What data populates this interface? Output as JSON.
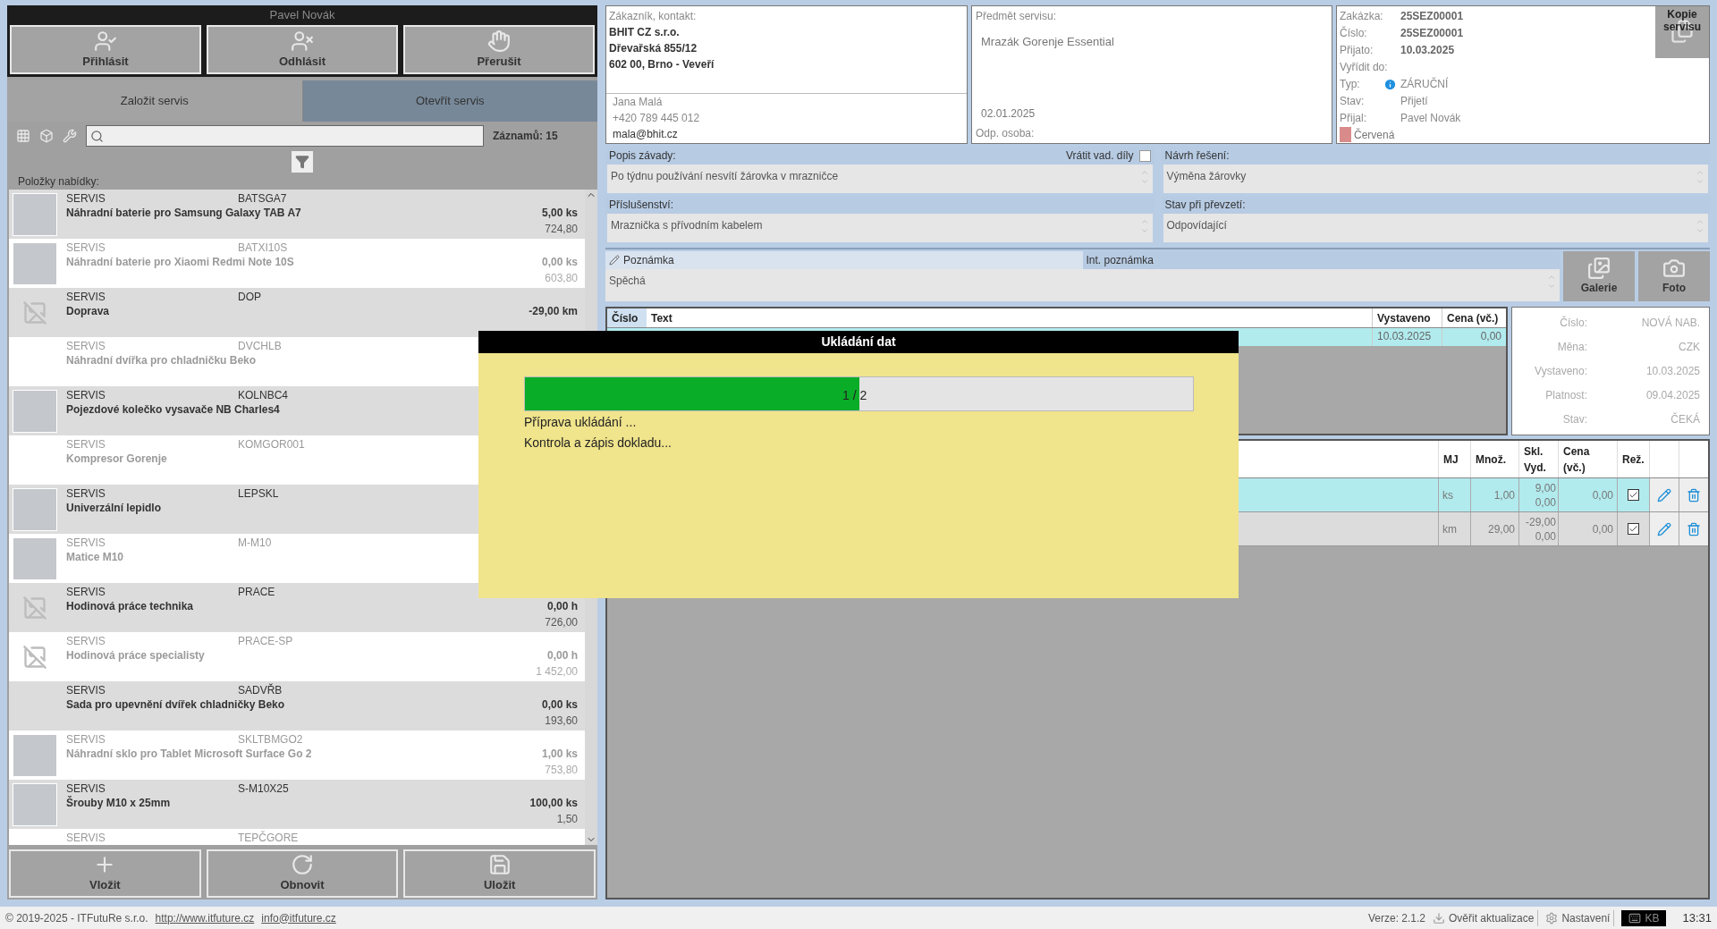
{
  "user": "Pavel Novák",
  "top_buttons": [
    {
      "label": "Přihlásit"
    },
    {
      "label": "Odhlásit"
    },
    {
      "label": "Přerušit"
    }
  ],
  "tabs": [
    {
      "label": "Založit servis",
      "selected": false
    },
    {
      "label": "Otevřít servis",
      "selected": true
    }
  ],
  "records": "Záznamů: 15",
  "list_title": "Položky nabídky:",
  "items": [
    {
      "category": "SERVIS",
      "code": "BATSGA7",
      "name": "Náhradní baterie pro Samsung Galaxy TAB A7",
      "qty": "5,00 ks",
      "price": "724,80",
      "kind": "photo",
      "available": true
    },
    {
      "category": "SERVIS",
      "code": "BATXI10S",
      "name": "Náhradní baterie pro Xiaomi Redmi Note 10S",
      "qty": "0,00 ks",
      "price": "603,80",
      "kind": "photo",
      "available": false
    },
    {
      "category": "SERVIS",
      "code": "DOP",
      "name": "Doprava",
      "qty": "-29,00 km",
      "kind": "no-image",
      "available": true
    },
    {
      "category": "SERVIS",
      "code": "DVCHLB",
      "name": "Náhradní dvířka pro chladničku Beko",
      "available": false
    },
    {
      "category": "SERVIS",
      "code": "KOLNBC4",
      "name": "Pojezdové kolečko vysavače NB Charles4",
      "kind": "photo",
      "available": true
    },
    {
      "category": "SERVIS",
      "code": "KOMGOR001",
      "name": "Kompresor Gorenje",
      "available": false
    },
    {
      "category": "SERVIS",
      "code": "LEPSKL",
      "name": "Univerzální lepidlo",
      "kind": "photo",
      "available": true
    },
    {
      "category": "SERVIS",
      "code": "M-M10",
      "name": "Matice M10",
      "kind": "photo",
      "available": false
    },
    {
      "category": "SERVIS",
      "code": "PRACE",
      "name": "Hodinová práce technika",
      "qty": "0,00 h",
      "price": "726,00",
      "kind": "no-image",
      "available": true
    },
    {
      "category": "SERVIS",
      "code": "PRACE-SP",
      "name": "Hodinová práce specialisty",
      "qty": "0,00 h",
      "price": "1 452,00",
      "kind": "no-image",
      "available": false
    },
    {
      "category": "SERVIS",
      "code": "SADVŘB",
      "name": "Sada pro upevnění dvířek chladničky Beko",
      "qty": "0,00 ks",
      "price": "193,60",
      "available": true
    },
    {
      "category": "SERVIS",
      "code": "SKLTBMGO2",
      "name": "Náhradní sklo pro Tablet Microsoft Surface Go 2",
      "qty": "1,00 ks",
      "price": "753,80",
      "kind": "photo",
      "available": false
    },
    {
      "category": "SERVIS",
      "code": "S-M10X25",
      "name": "Šrouby M10 x 25mm",
      "qty": "100,00 ks",
      "price": "1,50",
      "kind": "photo",
      "available": true
    },
    {
      "category": "SERVIS",
      "code": "TEPČGORE",
      "available": false
    }
  ],
  "bottom_buttons": [
    {
      "label": "Vložit"
    },
    {
      "label": "Obnovit"
    },
    {
      "label": "Uložit"
    }
  ],
  "customer": {
    "label": "Zákazník, kontakt:",
    "lines": [
      "BHIT CZ s.r.o.",
      "Dřevařská 855/12",
      "602 00, Brno - Veveří"
    ],
    "contact": [
      "Jana Malá",
      "+420 789 445 012"
    ],
    "email": "mala@bhit.cz"
  },
  "subject": {
    "label": "Předmět servisu:",
    "value": "Mrazák Gorenje Essential",
    "date": "02.01.2025",
    "person_label": "Odp. osoba:"
  },
  "order": {
    "fields": [
      {
        "label": "Zakázka:",
        "value": "25SEZ00001",
        "bold": true
      },
      {
        "label": "Číslo:",
        "value": "25SEZ00001",
        "bold": true
      },
      {
        "label": "Přijato:",
        "value": "10.03.2025",
        "bold": true
      },
      {
        "label": "Vyřídit do:"
      },
      {
        "label": "Typ:",
        "value": "ZÁRUČNÍ",
        "info": true,
        "bold": false
      },
      {
        "label": "Stav:",
        "value": "Přijetí",
        "bold": false
      },
      {
        "label": "Přijal:",
        "value": "Pavel Novák",
        "bold": false
      }
    ],
    "tag": {
      "label": "Červená",
      "color": "#d98b8b"
    },
    "copy_button": "Kopie servisu"
  },
  "description": {
    "label": "Popis závady:",
    "value": "Po týdnu používání nesvítí žárovka v mrazničce",
    "return_label": "Vrátit vad. díly",
    "return_checked": false
  },
  "solution": {
    "label": "Návrh řešení:",
    "value": "Výměna žárovky"
  },
  "accessories": {
    "label": "Příslušenství:",
    "value": "Mraznička s přívodním kabelem"
  },
  "condition": {
    "label": "Stav při převzetí:",
    "value": "Odpovídající"
  },
  "note_tabs": [
    {
      "label": "Poznámka",
      "selected": true
    },
    {
      "label": "Int. poznámka",
      "selected": false
    }
  ],
  "note": "Spěchá",
  "media_buttons": [
    {
      "label": "Galerie"
    },
    {
      "label": "Foto"
    }
  ],
  "offers": {
    "columns": [
      "Číslo",
      "Text",
      "Vystaveno",
      "Cena (vč.)"
    ],
    "rows": [
      {
        "issued": "10.03.2025",
        "price": "0,00",
        "selected": true
      }
    ]
  },
  "offer_info": [
    {
      "label": "Číslo:",
      "value": "NOVÁ NAB."
    },
    {
      "label": "Měna:",
      "value": "CZK"
    },
    {
      "label": "Vystaveno:",
      "value": "10.03.2025"
    },
    {
      "label": "Platnost:",
      "value": "09.04.2025"
    },
    {
      "label": "Stav:",
      "value": "ČEKÁ"
    }
  ],
  "lines": {
    "columns": [
      "MJ",
      "Množ.",
      "Skl. Vyd.",
      "Cena (vč.)",
      "Rež."
    ],
    "rows": [
      {
        "unit": "ks",
        "qty": "1,00",
        "stock": [
          "9,00",
          "0,00"
        ],
        "price": "0,00",
        "overhead": true,
        "selected": true
      },
      {
        "unit": "km",
        "qty": "29,00",
        "stock": [
          "-29,00",
          "0,00"
        ],
        "price": "0,00",
        "overhead": true,
        "selected": false
      }
    ]
  },
  "modal": {
    "title": "Ukládání dat",
    "level": 0.5,
    "progress": "1 / 2",
    "messages": [
      "Příprava ukládání ...",
      "Kontrola a zápis dokladu..."
    ]
  },
  "footer": {
    "copyright": "© 2019-2025 - ITFutuRe s.r.o.",
    "links": [
      "http://www.itfuture.cz",
      "info@itfuture.cz"
    ],
    "version": "Verze: 2.1.2",
    "update": "Ověřit aktualizace",
    "settings": "Nastavení",
    "keyboard": "KB",
    "time": "13:31"
  }
}
